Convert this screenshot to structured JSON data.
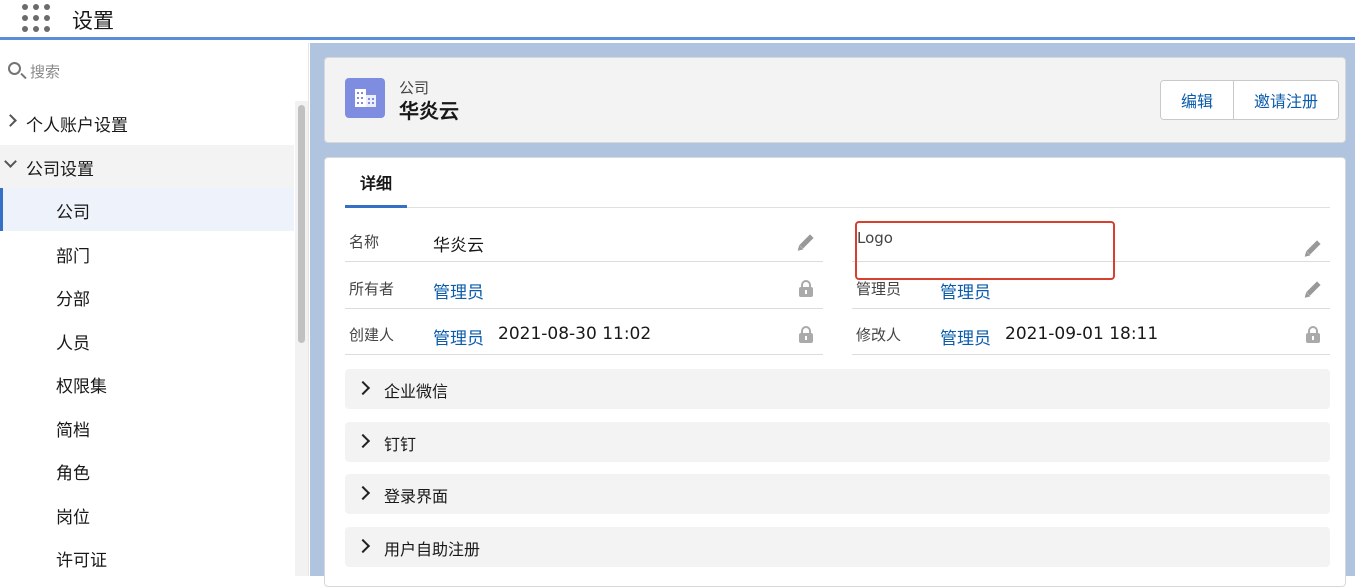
{
  "app": {
    "title": "设置",
    "launcher_icon": "app-launcher-grid-icon"
  },
  "sidebar": {
    "search_placeholder": "搜索",
    "groups": [
      {
        "label": "个人账户设置",
        "expanded": false
      },
      {
        "label": "公司设置",
        "expanded": true
      }
    ],
    "items": [
      "公司",
      "部门",
      "分部",
      "人员",
      "权限集",
      "简档",
      "角色",
      "岗位",
      "许可证"
    ],
    "active_item": "公司"
  },
  "record": {
    "type_label": "公司",
    "name": "华炎云",
    "icon": "building-icon",
    "actions": {
      "edit": "编辑",
      "invite": "邀请注册"
    }
  },
  "tabs": [
    {
      "label": "详细",
      "active": true
    }
  ],
  "fields": {
    "name": {
      "label": "名称",
      "value": "华炎云"
    },
    "logo": {
      "label": "Logo",
      "value": ""
    },
    "owner": {
      "label": "所有者",
      "value": "管理员"
    },
    "admin": {
      "label": "管理员",
      "value": "管理员"
    },
    "created_by": {
      "label": "创建人",
      "user": "管理员",
      "date": "2021-08-30 11:02"
    },
    "modified_by": {
      "label": "修改人",
      "user": "管理员",
      "date": "2021-09-01 18:11"
    }
  },
  "sections": [
    "企业微信",
    "钉钉",
    "登录界面",
    "用户自助注册"
  ],
  "colors": {
    "accent": "#3570c7",
    "link": "#0b5cab",
    "highlight": "#d6402e",
    "icon_bg": "#7f8de1"
  }
}
